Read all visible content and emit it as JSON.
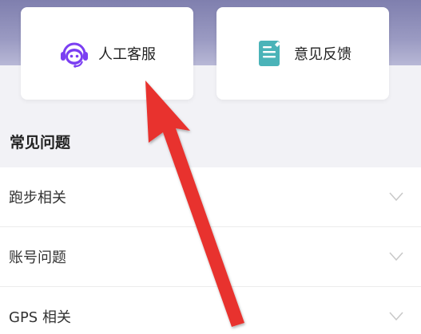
{
  "cards": {
    "customer_service": {
      "label": "人工客服",
      "icon": "headset-robot-icon",
      "color": "#7b3ff2"
    },
    "feedback": {
      "label": "意见反馈",
      "icon": "notepad-pen-icon",
      "color": "#4ab3b8"
    }
  },
  "faq": {
    "title": "常见问题",
    "items": [
      {
        "label": "跑步相关"
      },
      {
        "label": "账号问题"
      },
      {
        "label": "GPS 相关"
      }
    ]
  },
  "colors": {
    "header_gradient_top": "#7f7fae",
    "annotation_arrow": "#e8322d"
  }
}
